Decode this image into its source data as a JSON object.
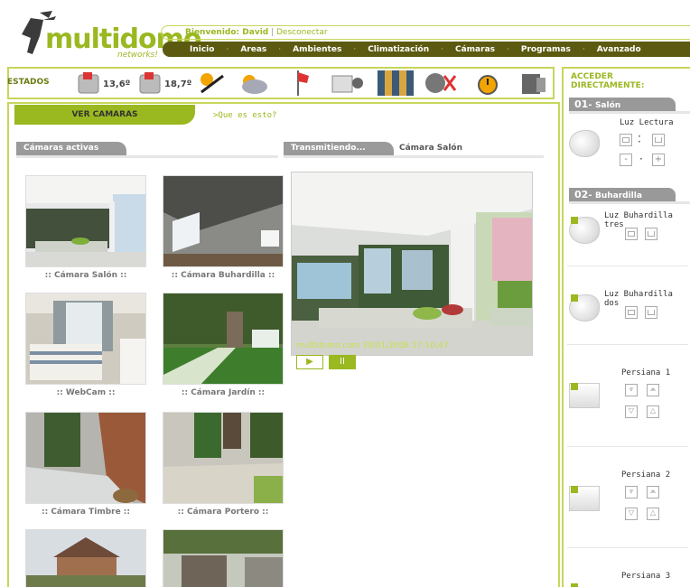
{
  "header": {
    "logo_main": "multidomo",
    "logo_sub": "networks!",
    "welcome_label": "Bienvenido: David",
    "logout_label": "Desconectar",
    "nav": [
      "Inicio",
      "Areas",
      "Ambientes",
      "Climatización",
      "Cámaras",
      "Programas",
      "Avanzado"
    ]
  },
  "estados": {
    "label": "ESTADOS",
    "temp1": "13,6º",
    "temp2": "18,7º"
  },
  "main": {
    "tab_title": "VER CAMARAS",
    "help_link": ">Que es esto?",
    "active_tab": "Cámaras activas",
    "transmitting_tab": "Transmitiendo...",
    "current_camera_tab": "Cámara Salón",
    "overlay": "multidomo.com 30/01/2008 17:10:47",
    "play_label": "▶",
    "pause_label": "II",
    "cameras": [
      ":: Cámara Salón ::",
      ":: Cámara Buhardilla ::",
      ":: WebCam ::",
      ":: Cámara Jardín ::",
      ":: Cámara Timbre ::",
      ":: Cámara Portero ::"
    ]
  },
  "sidebar": {
    "title_line1": "ACCEDER",
    "title_line2": "DIRECTAMENTE:",
    "rooms": [
      {
        "num": "01",
        "name": "Salón"
      },
      {
        "num": "02",
        "name": "Buhardilla"
      }
    ],
    "devices": [
      "Luz Lectura",
      "Luz Buhardilla tres",
      "Luz Buhardilla dos",
      "Persiana 1",
      "Persiana 2",
      "Persiana 3"
    ],
    "minus_label": "-",
    "plus_label": "+"
  },
  "colors": {
    "accent": "#9ab820",
    "nav": "#5c5a10",
    "border": "#c8d65a"
  }
}
